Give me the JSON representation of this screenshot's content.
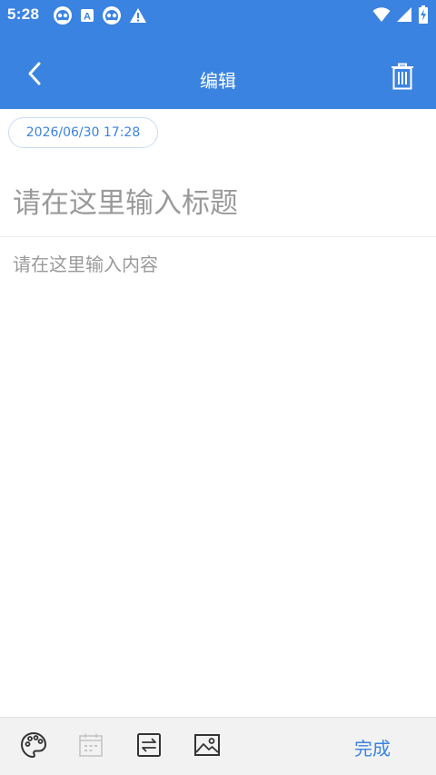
{
  "status_bar": {
    "time": "5:28",
    "left_icons": [
      "panda-notification-icon",
      "a-notification-icon",
      "panda-notification-icon",
      "warning-icon"
    ],
    "right_icons": [
      "wifi-icon",
      "signal-icon",
      "battery-charging-icon"
    ]
  },
  "header": {
    "title": "编辑",
    "back_icon": "chevron-left-icon",
    "delete_icon": "trash-icon"
  },
  "note": {
    "date": "2026/06/30 17:28",
    "title_placeholder": "请在这里输入标题",
    "title_value": "",
    "content_placeholder": "请在这里输入内容",
    "content_value": ""
  },
  "bottom_bar": {
    "tools": [
      "palette-icon",
      "calendar-icon",
      "swap-icon",
      "image-icon"
    ],
    "done_label": "完成"
  },
  "colors": {
    "primary": "#3b83e0",
    "chip_border": "#c7dcf5",
    "placeholder": "#9a9a9a",
    "bottom_bar_bg": "#f2f2f2"
  }
}
